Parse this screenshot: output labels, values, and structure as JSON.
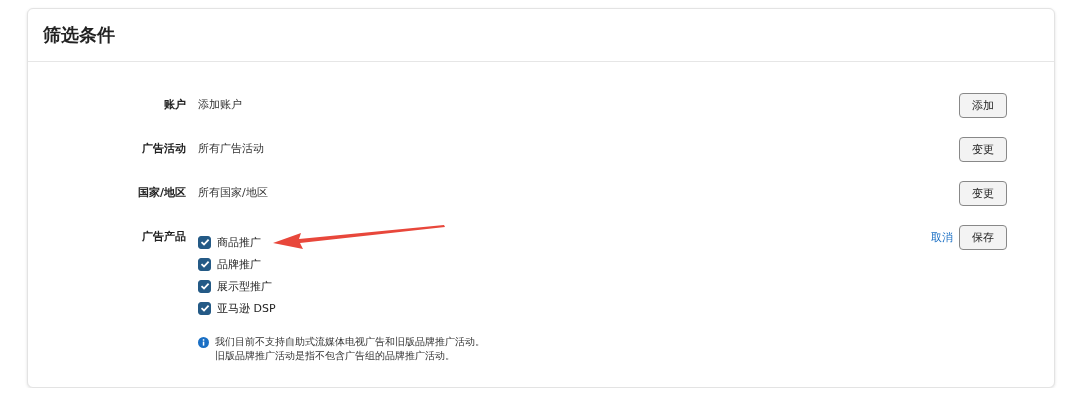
{
  "panel": {
    "title": "筛选条件"
  },
  "filters": [
    {
      "kind": "text",
      "label": "账户",
      "value": "添加账户",
      "actions": [
        {
          "kind": "button",
          "text": "添加"
        }
      ]
    },
    {
      "kind": "text",
      "label": "广告活动",
      "value": "所有广告活动",
      "actions": [
        {
          "kind": "button",
          "text": "变更"
        }
      ]
    },
    {
      "kind": "text",
      "label": "国家/地区",
      "value": "所有国家/地区",
      "actions": [
        {
          "kind": "button",
          "text": "变更"
        }
      ]
    },
    {
      "kind": "checkboxes",
      "label": "广告产品",
      "options": [
        {
          "label": "商品推广",
          "checked": true
        },
        {
          "label": "品牌推广",
          "checked": true
        },
        {
          "label": "展示型推广",
          "checked": true
        },
        {
          "label": "亚马逊 DSP",
          "checked": true
        }
      ],
      "note": [
        "我们目前不支持自助式流媒体电视广告和旧版品牌推广活动。",
        "旧版品牌推广活动是指不包含广告组的品牌推广活动。"
      ],
      "actions": [
        {
          "kind": "link",
          "text": "取消"
        },
        {
          "kind": "button",
          "text": "保存"
        }
      ]
    }
  ]
}
